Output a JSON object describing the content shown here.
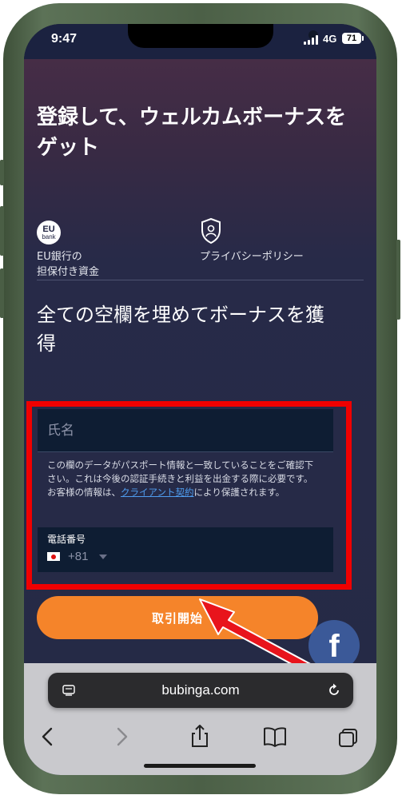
{
  "status_bar": {
    "time": "9:47",
    "network": "4G",
    "battery": "71"
  },
  "headline": "登録して、ウェルカムボーナスをゲット",
  "features": [
    {
      "icon": "eu-bank-icon",
      "badge_top": "EU",
      "badge_bottom": "bank",
      "label_line1": "EU銀行の",
      "label_line2": "担保付き資金"
    },
    {
      "icon": "shield-person-icon",
      "label_line1": "プライバシーポリシー"
    }
  ],
  "form": {
    "title": "全ての空欄を埋めてボーナスを獲得",
    "name_placeholder": "氏名",
    "note_before_link": "この欄のデータがパスポート情報と一致していることをご確認下さい。これは今後の認証手続きと利益を出金する際に必要です。お客様の情報は、",
    "note_link": "クライアント契約",
    "note_after_link": "により保護されます。",
    "phone_label": "電話番号",
    "phone_code": "+81"
  },
  "cta_label": "取引開始",
  "browser": {
    "url": "bubinga.com"
  },
  "colors": {
    "accent": "#f5842a",
    "highlight": "#f00000",
    "facebook": "#3b5998"
  }
}
